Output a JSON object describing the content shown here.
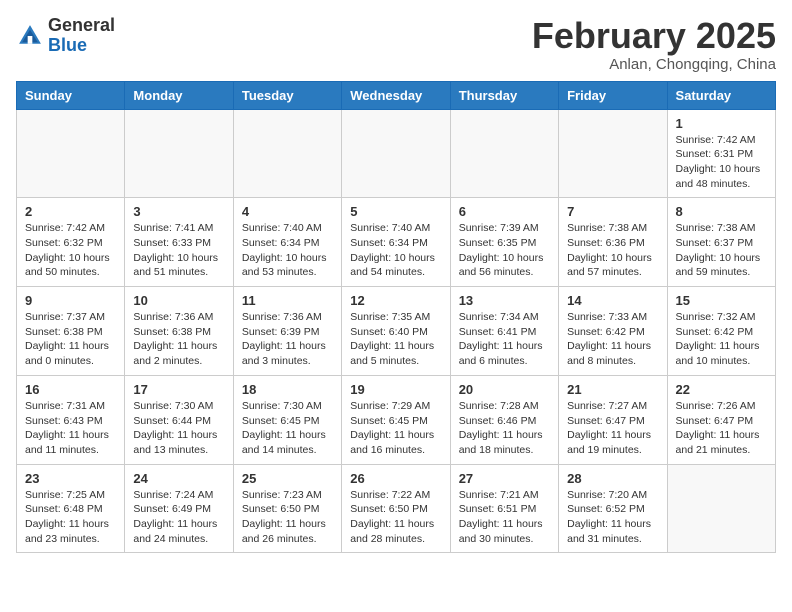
{
  "header": {
    "logo_line1": "General",
    "logo_line2": "Blue",
    "month": "February 2025",
    "location": "Anlan, Chongqing, China"
  },
  "weekdays": [
    "Sunday",
    "Monday",
    "Tuesday",
    "Wednesday",
    "Thursday",
    "Friday",
    "Saturday"
  ],
  "weeks": [
    [
      {
        "day": "",
        "info": ""
      },
      {
        "day": "",
        "info": ""
      },
      {
        "day": "",
        "info": ""
      },
      {
        "day": "",
        "info": ""
      },
      {
        "day": "",
        "info": ""
      },
      {
        "day": "",
        "info": ""
      },
      {
        "day": "1",
        "info": "Sunrise: 7:42 AM\nSunset: 6:31 PM\nDaylight: 10 hours and 48 minutes."
      }
    ],
    [
      {
        "day": "2",
        "info": "Sunrise: 7:42 AM\nSunset: 6:32 PM\nDaylight: 10 hours and 50 minutes."
      },
      {
        "day": "3",
        "info": "Sunrise: 7:41 AM\nSunset: 6:33 PM\nDaylight: 10 hours and 51 minutes."
      },
      {
        "day": "4",
        "info": "Sunrise: 7:40 AM\nSunset: 6:34 PM\nDaylight: 10 hours and 53 minutes."
      },
      {
        "day": "5",
        "info": "Sunrise: 7:40 AM\nSunset: 6:34 PM\nDaylight: 10 hours and 54 minutes."
      },
      {
        "day": "6",
        "info": "Sunrise: 7:39 AM\nSunset: 6:35 PM\nDaylight: 10 hours and 56 minutes."
      },
      {
        "day": "7",
        "info": "Sunrise: 7:38 AM\nSunset: 6:36 PM\nDaylight: 10 hours and 57 minutes."
      },
      {
        "day": "8",
        "info": "Sunrise: 7:38 AM\nSunset: 6:37 PM\nDaylight: 10 hours and 59 minutes."
      }
    ],
    [
      {
        "day": "9",
        "info": "Sunrise: 7:37 AM\nSunset: 6:38 PM\nDaylight: 11 hours and 0 minutes."
      },
      {
        "day": "10",
        "info": "Sunrise: 7:36 AM\nSunset: 6:38 PM\nDaylight: 11 hours and 2 minutes."
      },
      {
        "day": "11",
        "info": "Sunrise: 7:36 AM\nSunset: 6:39 PM\nDaylight: 11 hours and 3 minutes."
      },
      {
        "day": "12",
        "info": "Sunrise: 7:35 AM\nSunset: 6:40 PM\nDaylight: 11 hours and 5 minutes."
      },
      {
        "day": "13",
        "info": "Sunrise: 7:34 AM\nSunset: 6:41 PM\nDaylight: 11 hours and 6 minutes."
      },
      {
        "day": "14",
        "info": "Sunrise: 7:33 AM\nSunset: 6:42 PM\nDaylight: 11 hours and 8 minutes."
      },
      {
        "day": "15",
        "info": "Sunrise: 7:32 AM\nSunset: 6:42 PM\nDaylight: 11 hours and 10 minutes."
      }
    ],
    [
      {
        "day": "16",
        "info": "Sunrise: 7:31 AM\nSunset: 6:43 PM\nDaylight: 11 hours and 11 minutes."
      },
      {
        "day": "17",
        "info": "Sunrise: 7:30 AM\nSunset: 6:44 PM\nDaylight: 11 hours and 13 minutes."
      },
      {
        "day": "18",
        "info": "Sunrise: 7:30 AM\nSunset: 6:45 PM\nDaylight: 11 hours and 14 minutes."
      },
      {
        "day": "19",
        "info": "Sunrise: 7:29 AM\nSunset: 6:45 PM\nDaylight: 11 hours and 16 minutes."
      },
      {
        "day": "20",
        "info": "Sunrise: 7:28 AM\nSunset: 6:46 PM\nDaylight: 11 hours and 18 minutes."
      },
      {
        "day": "21",
        "info": "Sunrise: 7:27 AM\nSunset: 6:47 PM\nDaylight: 11 hours and 19 minutes."
      },
      {
        "day": "22",
        "info": "Sunrise: 7:26 AM\nSunset: 6:47 PM\nDaylight: 11 hours and 21 minutes."
      }
    ],
    [
      {
        "day": "23",
        "info": "Sunrise: 7:25 AM\nSunset: 6:48 PM\nDaylight: 11 hours and 23 minutes."
      },
      {
        "day": "24",
        "info": "Sunrise: 7:24 AM\nSunset: 6:49 PM\nDaylight: 11 hours and 24 minutes."
      },
      {
        "day": "25",
        "info": "Sunrise: 7:23 AM\nSunset: 6:50 PM\nDaylight: 11 hours and 26 minutes."
      },
      {
        "day": "26",
        "info": "Sunrise: 7:22 AM\nSunset: 6:50 PM\nDaylight: 11 hours and 28 minutes."
      },
      {
        "day": "27",
        "info": "Sunrise: 7:21 AM\nSunset: 6:51 PM\nDaylight: 11 hours and 30 minutes."
      },
      {
        "day": "28",
        "info": "Sunrise: 7:20 AM\nSunset: 6:52 PM\nDaylight: 11 hours and 31 minutes."
      },
      {
        "day": "",
        "info": ""
      }
    ]
  ]
}
